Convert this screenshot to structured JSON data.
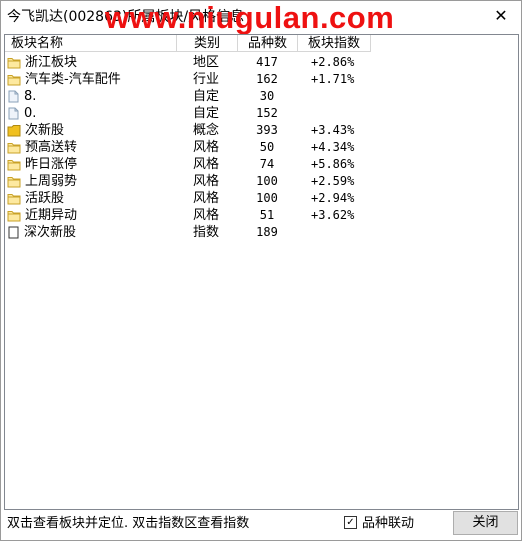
{
  "window": {
    "title": "今飞凯达(002863)所属板块/风格信息",
    "watermark": "www.niugulan.com",
    "close_glyph": "✕"
  },
  "columns": [
    "板块名称",
    "类别",
    "品种数",
    "板块指数"
  ],
  "rows": [
    {
      "name": "浙江板块",
      "type": "地区",
      "count": "417",
      "index": "+2.86%",
      "icon": "folder"
    },
    {
      "name": "汽车类-汽车配件",
      "type": "行业",
      "count": "162",
      "index": "+1.71%",
      "icon": "folder"
    },
    {
      "name": "8.",
      "type": "自定",
      "count": "30",
      "index": "",
      "icon": "page"
    },
    {
      "name": "0.",
      "type": "自定",
      "count": "152",
      "index": "",
      "icon": "page"
    },
    {
      "name": "次新股",
      "type": "概念",
      "count": "393",
      "index": "+3.43%",
      "icon": "folder-filled"
    },
    {
      "name": "预高送转",
      "type": "风格",
      "count": "50",
      "index": "+4.34%",
      "icon": "folder"
    },
    {
      "name": "昨日涨停",
      "type": "风格",
      "count": "74",
      "index": "+5.86%",
      "icon": "folder"
    },
    {
      "name": "上周弱势",
      "type": "风格",
      "count": "100",
      "index": "+2.59%",
      "icon": "folder"
    },
    {
      "name": "活跃股",
      "type": "风格",
      "count": "100",
      "index": "+2.94%",
      "icon": "folder"
    },
    {
      "name": "近期异动",
      "type": "风格",
      "count": "51",
      "index": "+3.62%",
      "icon": "folder"
    },
    {
      "name": "深次新股",
      "type": "指数",
      "count": "189",
      "index": "",
      "icon": "doc"
    }
  ],
  "footer": {
    "hint": "双击查看板块并定位. 双击指数区查看指数",
    "sync_label": "品种联动",
    "sync_checked": true,
    "close_button": "关闭"
  }
}
